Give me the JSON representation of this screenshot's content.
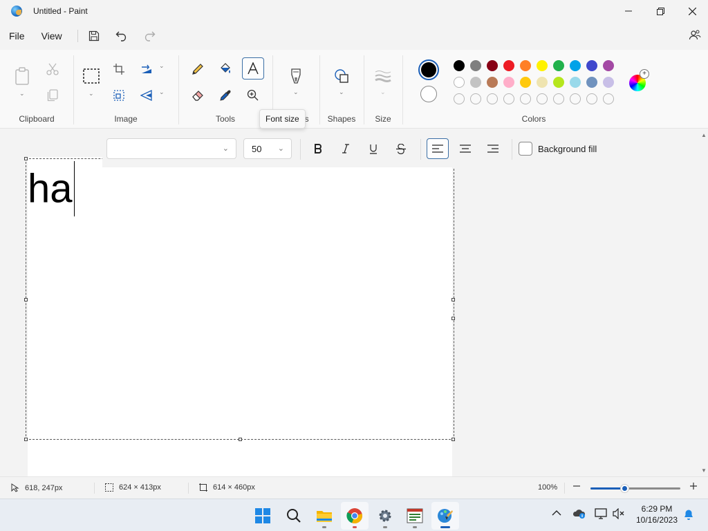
{
  "window": {
    "title": "Untitled - Paint"
  },
  "menu": {
    "file": "File",
    "view": "View"
  },
  "ribbon": {
    "groups": {
      "clipboard": "Clipboard",
      "image": "Image",
      "tools": "Tools",
      "brushes": "es",
      "shapes": "Shapes",
      "size": "Size",
      "colors": "Colors"
    },
    "tooltip": "Font size",
    "palette": {
      "row1": [
        "#000000",
        "#7f7f7f",
        "#880015",
        "#ed1c24",
        "#ff7f27",
        "#fff200",
        "#22b14c",
        "#00a2e8",
        "#3f48cc",
        "#a349a4"
      ],
      "row2": [
        "#ffffff",
        "#c3c3c3",
        "#b97a57",
        "#ffaec9",
        "#ffc90e",
        "#efe4b0",
        "#b5e61d",
        "#99d9ea",
        "#7092be",
        "#c8bfe7"
      ]
    },
    "primary_color": "#000000",
    "secondary_color": "#ffffff"
  },
  "text_toolbar": {
    "font_name": "",
    "font_size": "50",
    "background_fill_label": "Background fill"
  },
  "canvas": {
    "text": "ha"
  },
  "status": {
    "cursor_pos": "618, 247px",
    "selection_size": "624 × 413px",
    "canvas_size": "614 × 460px",
    "zoom": "100%",
    "zoom_fraction": 0.38
  },
  "taskbar": {
    "time": "6:29 PM",
    "date": "10/16/2023"
  }
}
